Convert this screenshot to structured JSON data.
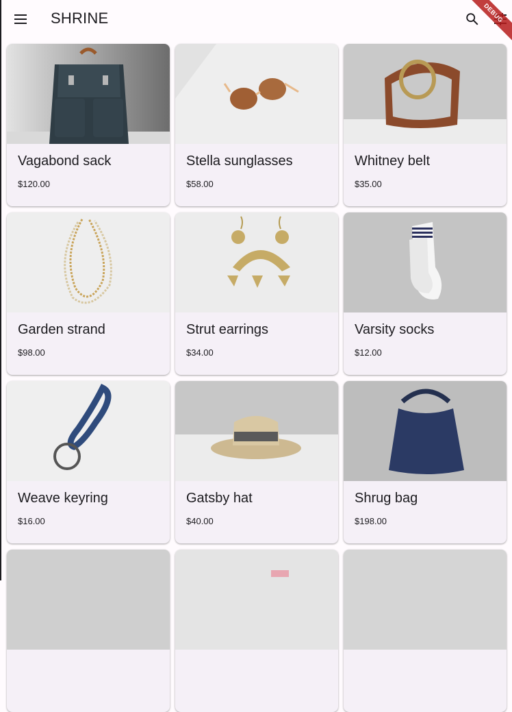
{
  "app_bar": {
    "title": "SHRINE",
    "debug_label": "DEBUG"
  },
  "icons": {
    "menu": "menu-icon",
    "search": "search-icon",
    "filter": "tune-icon"
  },
  "products": [
    {
      "name": "Vagabond sack",
      "price": "$120.00",
      "image": "backpack"
    },
    {
      "name": "Stella sunglasses",
      "price": "$58.00",
      "image": "sunglasses"
    },
    {
      "name": "Whitney belt",
      "price": "$35.00",
      "image": "belt"
    },
    {
      "name": "Garden strand",
      "price": "$98.00",
      "image": "necklace"
    },
    {
      "name": "Strut earrings",
      "price": "$34.00",
      "image": "earrings"
    },
    {
      "name": "Varsity socks",
      "price": "$12.00",
      "image": "socks"
    },
    {
      "name": "Weave keyring",
      "price": "$16.00",
      "image": "keyring"
    },
    {
      "name": "Gatsby hat",
      "price": "$40.00",
      "image": "hat"
    },
    {
      "name": "Shrug bag",
      "price": "$198.00",
      "image": "bag"
    }
  ]
}
